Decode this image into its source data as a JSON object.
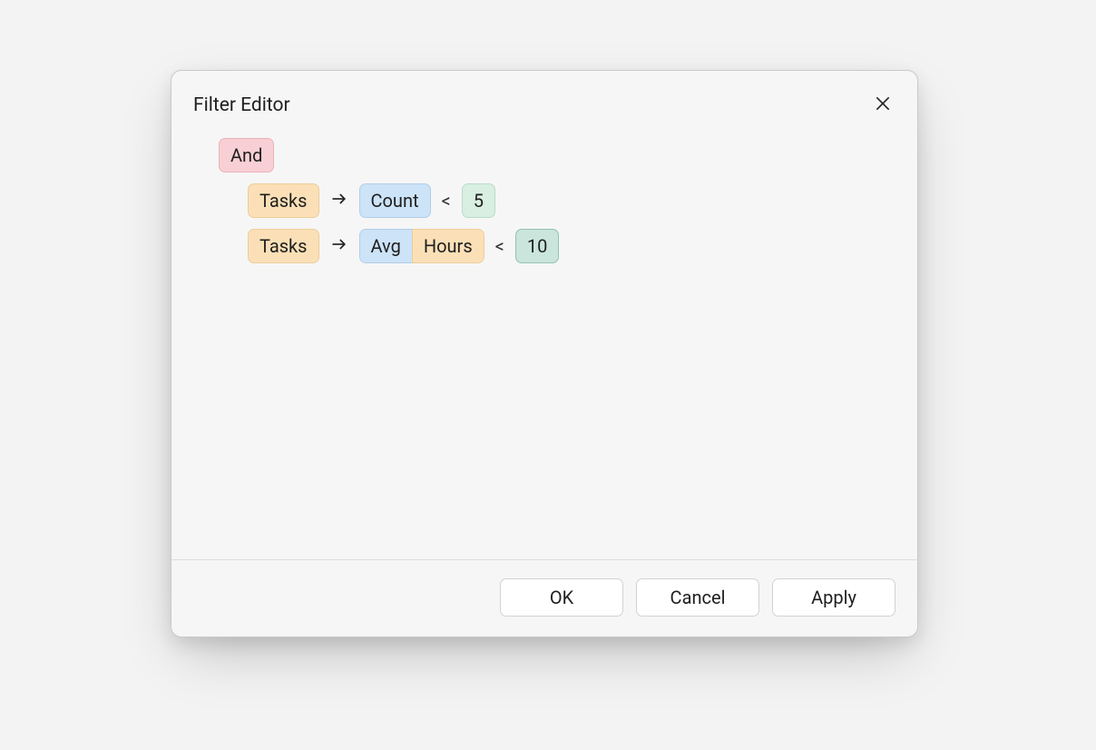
{
  "dialog": {
    "title": "Filter Editor"
  },
  "filter": {
    "group_operator": "And",
    "conditions": [
      {
        "property": "Tasks",
        "aggregate": "Count",
        "field": null,
        "comparison": "<",
        "value": "5",
        "value_emphasis": false
      },
      {
        "property": "Tasks",
        "aggregate": "Avg",
        "field": "Hours",
        "comparison": "<",
        "value": "10",
        "value_emphasis": true
      }
    ]
  },
  "buttons": {
    "ok": "OK",
    "cancel": "Cancel",
    "apply": "Apply"
  }
}
